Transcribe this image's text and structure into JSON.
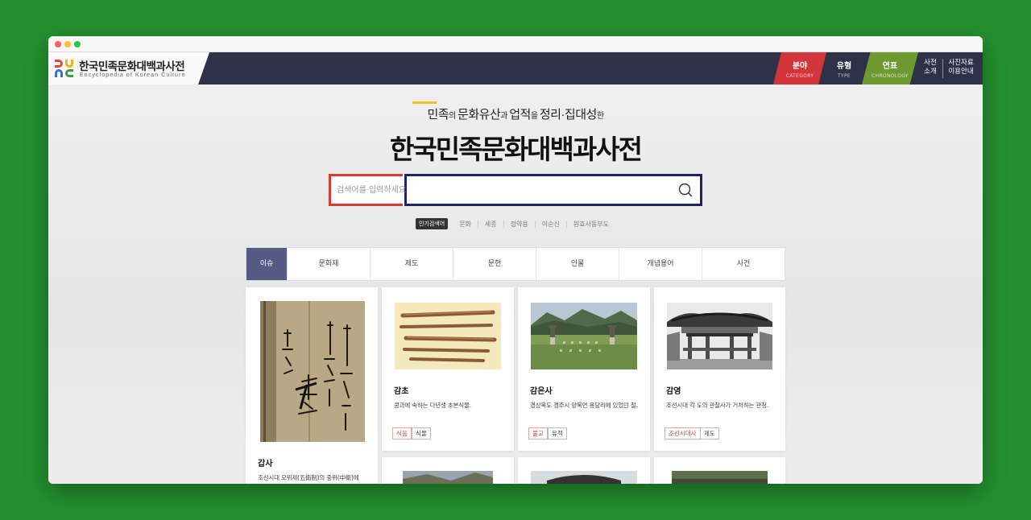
{
  "header": {
    "logo_title": "한국민족문화대백과사전",
    "logo_subtitle": "Encyclopedia of Korean Culture",
    "nav": [
      {
        "ko": "분야",
        "en": "CATEGORY",
        "color": "#d2363a"
      },
      {
        "ko": "유형",
        "en": "TYPE",
        "color": "#2e3148"
      },
      {
        "ko": "연표",
        "en": "CHRONOLOGY",
        "color": "#6c9a2e"
      }
    ],
    "about_line1": "사전",
    "about_line2": "소개",
    "guide_line1": "사진자료",
    "guide_line2": "이용안내"
  },
  "hero": {
    "tag1": "민족",
    "tag2": "의 ",
    "tag3": "문화유산",
    "tag4": "과 ",
    "tag5": "업적",
    "tag6": "을 ",
    "tag7": "정리·집대성",
    "tag8": "한",
    "title": "한국민족문화대백과사전"
  },
  "search": {
    "placeholder": "검색어를 입력하세요"
  },
  "popular": {
    "badge": "인기검색어",
    "items": [
      "문화",
      "세종",
      "정약용",
      "이순신",
      "원효사동부도"
    ]
  },
  "tabs": [
    "이슈",
    "문화재",
    "제도",
    "문헌",
    "인물",
    "개념용어",
    "사건"
  ],
  "cards": [
    {
      "title": "갑사",
      "desc": "조선시대 오위제(五衛制)의 중위(中衛)에"
    },
    {
      "title": "감초",
      "desc": "콩과에 속하는 다년생 초본식물.",
      "tags": [
        "식음",
        "식물"
      ]
    },
    {
      "title": "감은사",
      "desc": "경상북도 경주시 양북면 용당리에 있었던 절.",
      "tags": [
        "불교",
        "유적"
      ]
    },
    {
      "title": "감영",
      "desc": "조선시대 각 도의 관찰사가 거처하는 관청.",
      "tags": [
        "조선시대사",
        "제도"
      ]
    }
  ],
  "colors": {
    "header_bg": "#2e3148",
    "category_red": "#d2363a",
    "chronology_green": "#6c9a2e",
    "active_tab": "#555a85",
    "search_left": "#d93a34",
    "search_right": "#1f2361"
  }
}
